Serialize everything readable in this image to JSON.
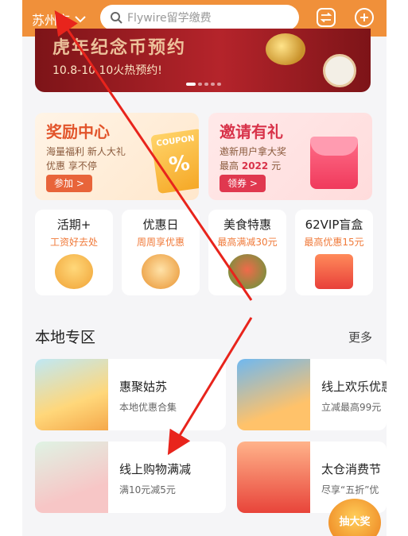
{
  "header": {
    "city": "苏州市",
    "search_placeholder": "Flywire留学缴费"
  },
  "banner": {
    "title": "虎年纪念币预约",
    "subtitle": "10.8-10.10火热预约!"
  },
  "promos": [
    {
      "title": "奖励中心",
      "line1": "海量福利 新人大礼",
      "line2": "优惠 享不停",
      "button": "参加 >",
      "coupon_text": "COUPON",
      "coupon_symbol": "%"
    },
    {
      "title": "邀请有礼",
      "line1": "邀新用户拿大奖",
      "line2_prefix": "最高",
      "line2_highlight": "2022",
      "line2_suffix": "元",
      "button": "领券 >"
    }
  ],
  "tiles": [
    {
      "title": "活期+",
      "subtitle": "工资好去处"
    },
    {
      "title": "优惠日",
      "subtitle": "周周享优惠"
    },
    {
      "title": "美食特惠",
      "subtitle": "最高满减30元"
    },
    {
      "title": "62VIP盲盒",
      "subtitle": "最高优惠15元"
    }
  ],
  "local_zone": {
    "title": "本地专区",
    "more": "更多",
    "cards": [
      {
        "title": "惠聚姑苏",
        "subtitle": "本地优惠合集"
      },
      {
        "title": "线上欢乐优惠",
        "subtitle": "立减最高99元"
      },
      {
        "title": "线上购物满减",
        "subtitle": "满10元减5元"
      },
      {
        "title": "太仓消费节",
        "subtitle": "尽享“五折”优"
      }
    ]
  },
  "floating_badge": "抽大奖",
  "colors": {
    "brand_orange": "#f0903a",
    "annotation_red": "#e8241c"
  }
}
